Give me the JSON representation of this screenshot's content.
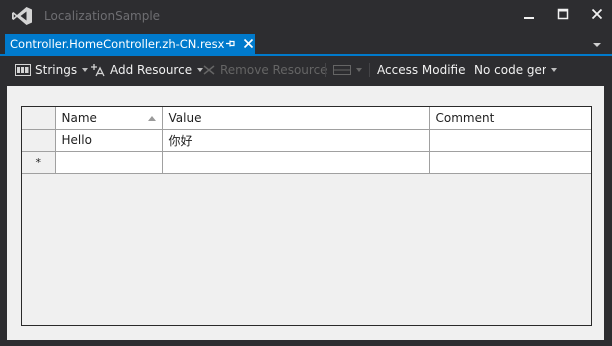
{
  "window": {
    "title": "LocalizationSample",
    "controls": {
      "minimize": "minimize-icon",
      "maximize": "maximize-icon",
      "close": "close-icon"
    }
  },
  "tab": {
    "title": "Controller.HomeController.zh-CN.resx",
    "pin_icon": "pin-icon",
    "close_icon": "close-icon"
  },
  "toolbar": {
    "strings_label": "Strings",
    "add_resource_label": "Add Resource",
    "remove_resource_label": "Remove Resource",
    "views_label": "",
    "access_modifier_label": "Access Modifier:",
    "access_modifier_value": "No code generation"
  },
  "grid": {
    "columns": [
      "Name",
      "Value",
      "Comment"
    ],
    "rows": [
      {
        "name": "Hello",
        "value": "你好",
        "comment": ""
      }
    ],
    "new_row_marker": "*"
  },
  "colors": {
    "accent": "#007acc",
    "chrome": "#2d2d30",
    "editor_bg": "#f0f0f0"
  }
}
